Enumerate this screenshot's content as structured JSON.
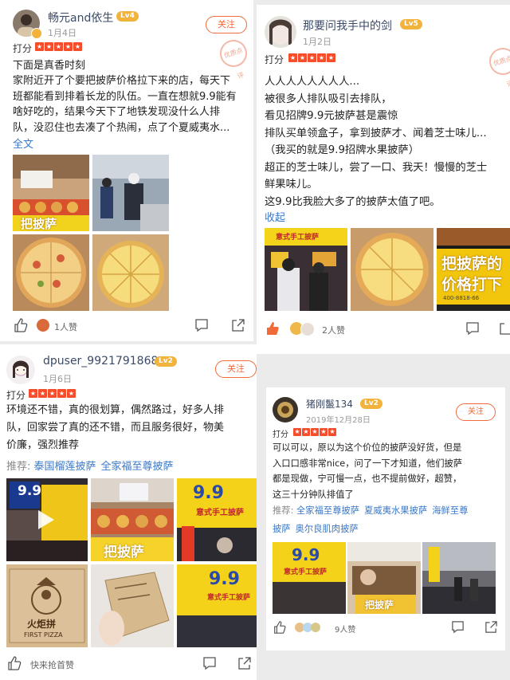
{
  "reviews": [
    {
      "username": "畅元and依生",
      "level": "Lv4",
      "date": "1月4日",
      "follow_label": "关注",
      "score_label": "打分",
      "stamp_text": "优质点评",
      "text": "下面是真香时刻\n家附近开了个要把披萨价格拉下来的店，每天下\n班都能看到排着长龙的队伍。一直在想就9.9能有\n啥好吃的，结果今天下了地铁发现没什么人排\n队，没忍住也去凑了个热闹，点了个夏威夷水...",
      "expand_label": "全文",
      "like_count_label": "1人赞"
    },
    {
      "username": "那要问我手中的剑",
      "level": "Lv5",
      "date": "1月2日",
      "score_label": "打分",
      "stamp_text": "优质点评",
      "text": "人人人人人人人人...\n被很多人排队吸引去排队，\n看见招牌9.9元披萨甚是震惊\n排队买单领盒子，拿到披萨才、闻着芝士味儿...\n（我买的就是9.9招牌水果披萨）\n超正的芝士味儿，尝了一口、我天！慢慢的芝士\n鲜果味儿。\n这9.9比我脸大多了的披萨太值了吧。",
      "collapse_label": "收起",
      "like_count_label": "2人赞"
    },
    {
      "username": "dpuser_9921791868",
      "level": "Lv2",
      "date": "1月6日",
      "follow_label": "关注",
      "score_label": "打分",
      "text": "环境还不错，真的很划算，偶然路过，好多人排\n队，回家尝了真的还不错，而且服务很好，物美\n价廉，强烈推荐",
      "recommend_label": "推荐:",
      "tags": [
        "泰国榴莲披萨",
        "全家福至尊披萨"
      ],
      "like_count_label": "快来抢首赞"
    },
    {
      "username": "猪刚鬣134",
      "level": "Lv2",
      "date": "2019年12月28日",
      "follow_label": "关注",
      "score_label": "打分",
      "text": "可以可以，原以为这个价位的披萨没好货，但是\n入口口感非常nice，问了一下才知道，他们披萨\n都是现做，宁可慢一点，也不提前做好，超赞，\n这三十分钟队排值了",
      "recommend_label": "推荐:",
      "tags": [
        "全家福至尊披萨",
        "夏威夷水果披萨",
        "海鲜至尊"
      ],
      "tags_line2": [
        "披萨",
        "奥尔良肌肉披萨"
      ],
      "like_count_label": "9人赞"
    }
  ],
  "photo_text": {
    "sign_brand": "把披萨",
    "sign_price": "9.9",
    "sign_yuan": "元",
    "sign_sub": "意式手工披萨",
    "sign_big1": "把披萨的",
    "sign_big2": "价格打下",
    "sign_phone": "400-8818-66",
    "box_name": "火炬拼",
    "box_en": "FIRST PIZZA"
  },
  "colors": {
    "accent": "#f06a3a",
    "star": "#f54d2c",
    "link": "#3a78c8",
    "level_badge": "#f2b33d",
    "liked": "#f06a3a"
  }
}
